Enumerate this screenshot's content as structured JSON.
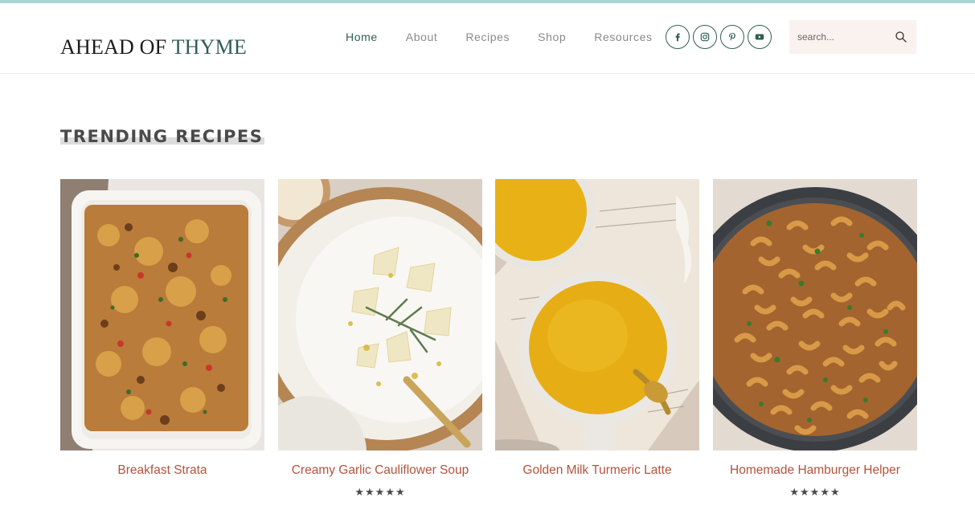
{
  "site": {
    "logo_part1": "AHEAD OF ",
    "logo_part2": "THYME",
    "brand_color": "#2f5d52",
    "link_color": "#b2533e"
  },
  "nav": {
    "items": [
      {
        "label": "Home",
        "active": true
      },
      {
        "label": "About",
        "active": false
      },
      {
        "label": "Recipes",
        "active": false
      },
      {
        "label": "Shop",
        "active": false
      },
      {
        "label": "Resources",
        "active": false
      }
    ]
  },
  "social": {
    "icons": [
      "facebook-icon",
      "instagram-icon",
      "pinterest-icon",
      "youtube-icon"
    ]
  },
  "search": {
    "placeholder": "search...",
    "icon": "search-icon"
  },
  "trending": {
    "heading": "TRENDING RECIPES",
    "recipes": [
      {
        "title": "Breakfast Strata",
        "rating": ""
      },
      {
        "title": "Creamy Garlic Cauliflower Soup",
        "rating": "★★★★★"
      },
      {
        "title": "Golden Milk Turmeric Latte",
        "rating": ""
      },
      {
        "title": "Homemade Hamburger Helper",
        "rating": "★★★★★"
      }
    ]
  }
}
